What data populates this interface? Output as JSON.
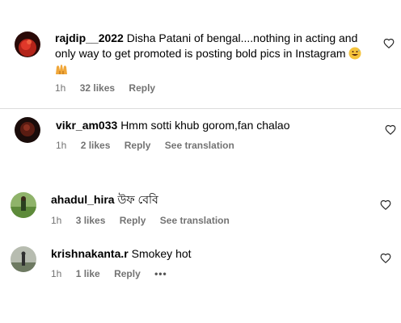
{
  "comments": [
    {
      "username": "rajdip__2022",
      "text": "Disha Patani of bengal....nothing in acting and only way to get promoted is posting bold pics in Instagram",
      "time": "1h",
      "likes": "32 likes",
      "reply": "Reply",
      "avatar": "red-fire-avatar",
      "emojis": [
        "grinning-sweat-emoji",
        "raising-hands-emoji"
      ]
    },
    {
      "username": "vikr_am033",
      "text": "Hmm sotti khub gorom,fan chalao",
      "time": "1h",
      "likes": "2 likes",
      "reply": "Reply",
      "translation": "See translation",
      "avatar": "dark-red-avatar"
    },
    {
      "username": "ahadul_hira",
      "text": "উফ বেবি",
      "time": "1h",
      "likes": "3 likes",
      "reply": "Reply",
      "translation": "See translation",
      "avatar": "green-field-avatar"
    },
    {
      "username": "krishnakanta.r",
      "text": "Smokey hot",
      "time": "1h",
      "likes": "1 like",
      "reply": "Reply",
      "more": "•••",
      "avatar": "grey-landscape-avatar"
    }
  ],
  "icons": {
    "like": "heart-outline-icon",
    "more": "more-options-icon"
  },
  "colors": {
    "meta_text": "#737373",
    "divider": "#dbdbdb",
    "text": "#000000"
  }
}
